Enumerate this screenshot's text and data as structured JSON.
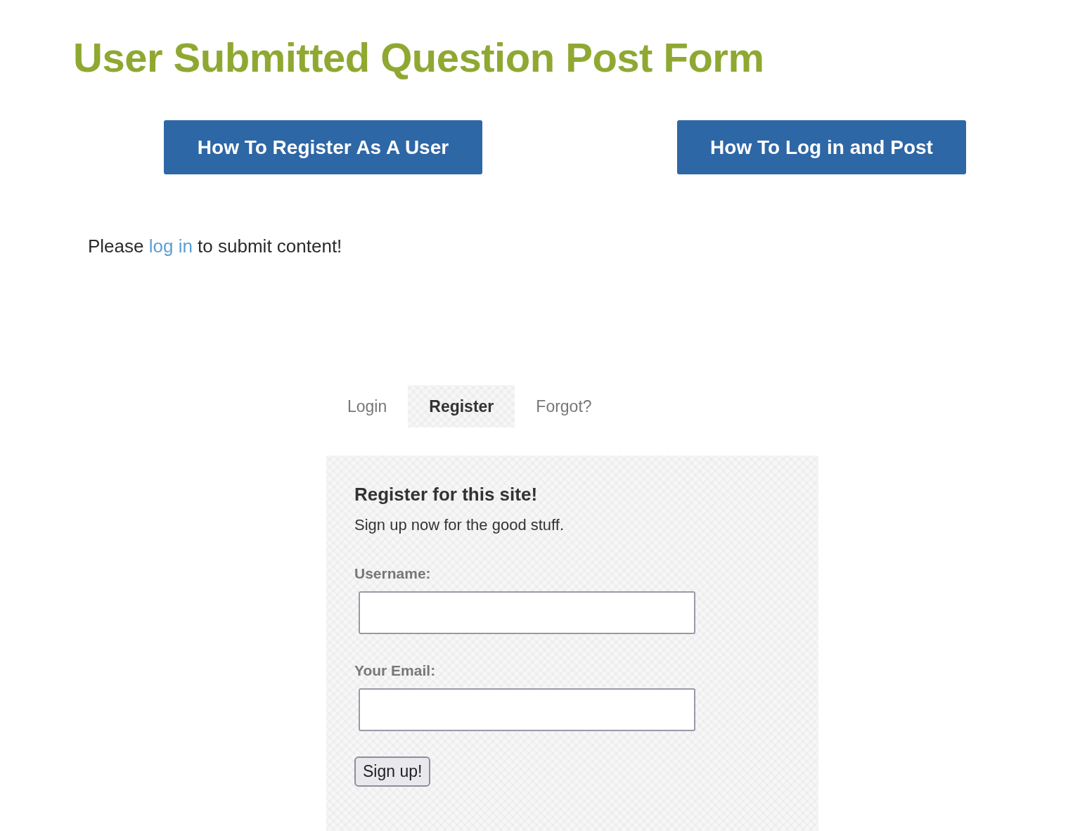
{
  "title": "User Submitted Question Post Form",
  "buttons": [
    {
      "label": "How To Register As A User"
    },
    {
      "label": "How To Log in and Post"
    }
  ],
  "notice": {
    "before": "Please ",
    "link": "log in",
    "after": " to submit content!"
  },
  "tabs": [
    {
      "label": "Login",
      "selected": false
    },
    {
      "label": "Register",
      "selected": true
    },
    {
      "label": "Forgot?",
      "selected": false
    }
  ],
  "form": {
    "heading": "Register for this site!",
    "subtitle": "Sign up now for the good stuff.",
    "fields": [
      {
        "label": "Username:"
      },
      {
        "label": "Your Email:"
      }
    ],
    "submit": "Sign up!"
  }
}
